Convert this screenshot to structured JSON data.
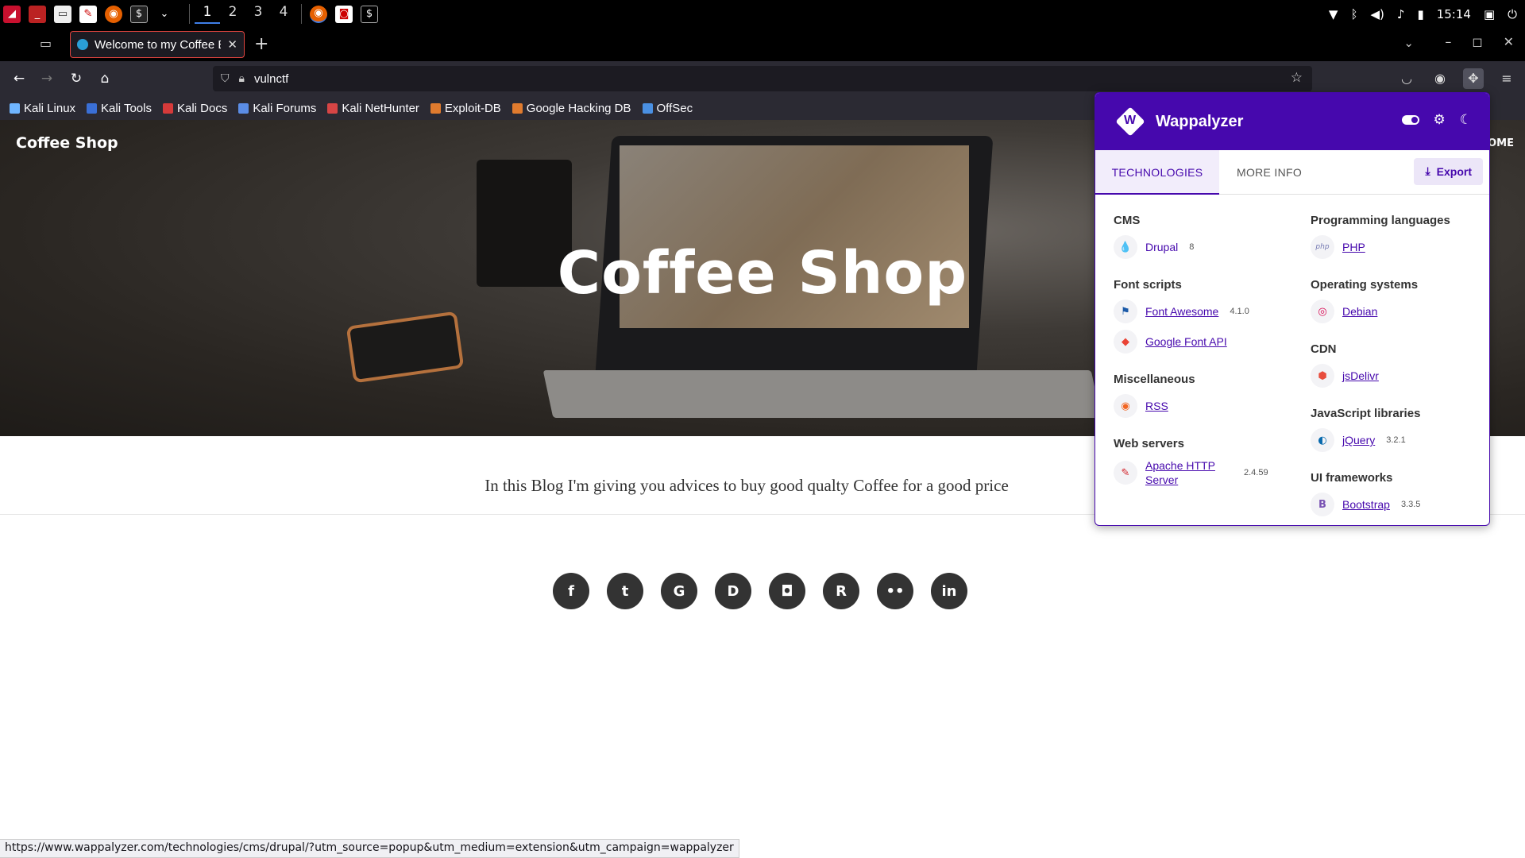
{
  "taskbar": {
    "workspaces": [
      "1",
      "2",
      "3",
      "4"
    ],
    "clock": "15:14"
  },
  "browser": {
    "tab_title": "Welcome to my Coffee Bl",
    "url": "vulnctf",
    "bookmarks": [
      {
        "label": "Kali Linux",
        "color": "#6fb5ff"
      },
      {
        "label": "Kali Tools",
        "color": "#3a6fd6"
      },
      {
        "label": "Kali Docs",
        "color": "#d63a3a"
      },
      {
        "label": "Kali Forums",
        "color": "#5b8de6"
      },
      {
        "label": "Kali NetHunter",
        "color": "#d64545"
      },
      {
        "label": "Exploit-DB",
        "color": "#e07b2e"
      },
      {
        "label": "Google Hacking DB",
        "color": "#e07b2e"
      },
      {
        "label": "OffSec",
        "color": "#4a90e2"
      }
    ],
    "status_url": "https://www.wappalyzer.com/technologies/cms/drupal/?utm_source=popup&utm_medium=extension&utm_campaign=wappalyzer"
  },
  "site": {
    "brand": "Coffee Shop",
    "hero_title": "Coffee Shop",
    "tagline": "In this Blog I'm giving you advices to buy good qualty Coffee for a good price",
    "nav_partial": "OME",
    "social": [
      {
        "name": "facebook-icon",
        "glyph": "f"
      },
      {
        "name": "twitter-icon",
        "glyph": "t"
      },
      {
        "name": "github-icon",
        "glyph": "G"
      },
      {
        "name": "drupal-icon",
        "glyph": "D"
      },
      {
        "name": "instagram-icon",
        "glyph": "◘"
      },
      {
        "name": "reddit-icon",
        "glyph": "R"
      },
      {
        "name": "flickr-icon",
        "glyph": "••"
      },
      {
        "name": "linkedin-icon",
        "glyph": "in"
      }
    ]
  },
  "wappalyzer": {
    "title": "Wappalyzer",
    "tabs": {
      "technologies": "TECHNOLOGIES",
      "more_info": "MORE INFO"
    },
    "export_label": "Export",
    "accent": "#4608ad",
    "left_column": [
      {
        "category": "CMS",
        "techs": [
          {
            "name": "Drupal",
            "version": "8",
            "icon": "drupal-icon",
            "glyph": "💧",
            "color": "#0678be"
          }
        ]
      },
      {
        "category": "Font scripts",
        "techs": [
          {
            "name": "Font Awesome",
            "version": "4.1.0",
            "icon": "font-awesome-icon",
            "glyph": "⚑",
            "color": "#1c5aa8"
          },
          {
            "name": "Google Font API",
            "version": "",
            "icon": "google-font-api-icon",
            "glyph": "◆",
            "color": "#ea4335"
          }
        ]
      },
      {
        "category": "Miscellaneous",
        "techs": [
          {
            "name": "RSS",
            "version": "",
            "icon": "rss-icon",
            "glyph": "◉",
            "color": "#f26522"
          }
        ]
      },
      {
        "category": "Web servers",
        "techs": [
          {
            "name": "Apache HTTP Server",
            "version": "2.4.59",
            "icon": "apache-icon",
            "glyph": "✎",
            "color": "#d22128"
          }
        ]
      }
    ],
    "right_column": [
      {
        "category": "Programming languages",
        "techs": [
          {
            "name": "PHP",
            "version": "",
            "icon": "php-icon",
            "glyph": "php",
            "color": "#777bb3"
          }
        ]
      },
      {
        "category": "Operating systems",
        "techs": [
          {
            "name": "Debian",
            "version": "",
            "icon": "debian-icon",
            "glyph": "◎",
            "color": "#d70a53"
          }
        ]
      },
      {
        "category": "CDN",
        "techs": [
          {
            "name": "jsDelivr",
            "version": "",
            "icon": "jsdelivr-icon",
            "glyph": "⬢",
            "color": "#e84d3d"
          }
        ]
      },
      {
        "category": "JavaScript libraries",
        "techs": [
          {
            "name": "jQuery",
            "version": "3.2.1",
            "icon": "jquery-icon",
            "glyph": "◐",
            "color": "#0769ad"
          }
        ]
      },
      {
        "category": "UI frameworks",
        "techs": [
          {
            "name": "Bootstrap",
            "version": "3.3.5",
            "icon": "bootstrap-icon",
            "glyph": "B",
            "color": "#7952b3"
          }
        ]
      }
    ]
  }
}
